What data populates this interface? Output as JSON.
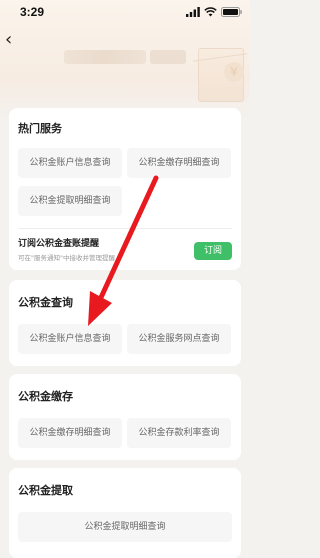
{
  "status_bar": {
    "time": "3:29"
  },
  "hero": {
    "coin_symbol": "¥"
  },
  "hot_services": {
    "title": "热门服务",
    "items": [
      "公积金账户信息查询",
      "公积金缴存明细查询",
      "公积金提取明细查询"
    ],
    "subscribe": {
      "title": "订阅公积金查账提醒",
      "note": "可在\"服务通知\"中接收并管理提醒",
      "button": "订阅"
    }
  },
  "query_section": {
    "title": "公积金查询",
    "items": [
      "公积金账户信息查询",
      "公积金服务网点查询"
    ]
  },
  "deposit_section": {
    "title": "公积金缴存",
    "items": [
      "公积金缴存明细查询",
      "公积金存款利率查询"
    ]
  },
  "withdraw_section": {
    "title": "公积金提取",
    "items": [
      "公积金提取明细查询"
    ]
  },
  "colors": {
    "accent_green": "#3fbf67",
    "arrow_red": "#e8191f"
  }
}
